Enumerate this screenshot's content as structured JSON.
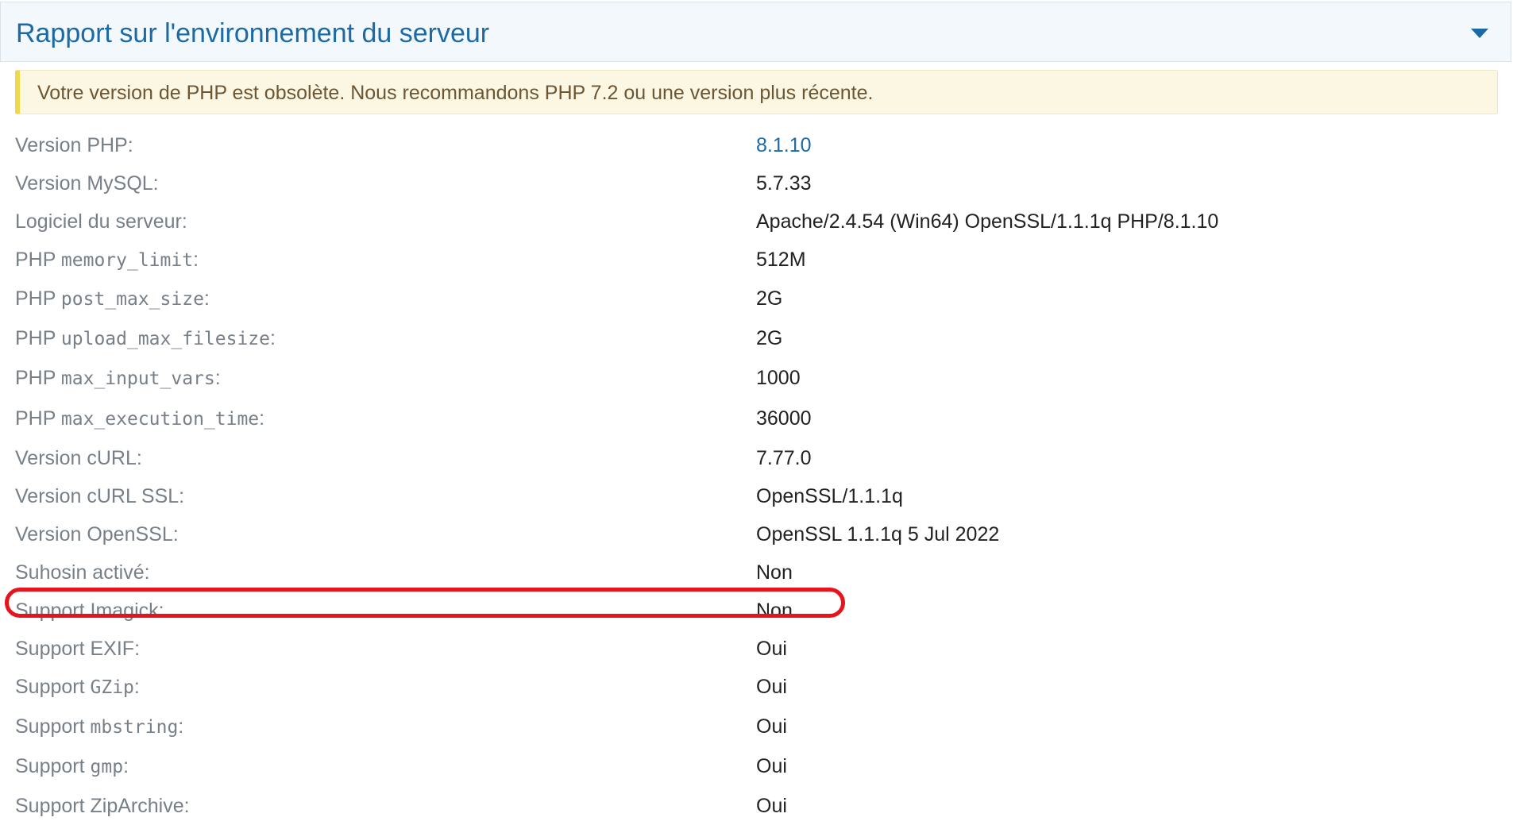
{
  "panel": {
    "title": "Rapport sur l'environnement du serveur",
    "toggle_icon": "caret-down-icon",
    "accent_color": "#1c6aa5"
  },
  "notice": {
    "text": "Votre version de PHP est obsolète. Nous recommandons PHP 7.2 ou une version plus récente.",
    "background_color": "#fcf7e3",
    "border_color": "#efd849"
  },
  "rows": [
    {
      "prefix": "Version PHP:",
      "code": "",
      "suffix": "",
      "value": "8.1.10"
    },
    {
      "prefix": "Version MySQL:",
      "code": "",
      "suffix": "",
      "value": "5.7.33"
    },
    {
      "prefix": "Logiciel du serveur:",
      "code": "",
      "suffix": "",
      "value": "Apache/2.4.54 (Win64) OpenSSL/1.1.1q PHP/8.1.10"
    },
    {
      "prefix": "PHP ",
      "code": "memory_limit",
      "suffix": ":",
      "value": "512M"
    },
    {
      "prefix": "PHP ",
      "code": "post_max_size",
      "suffix": ":",
      "value": "2G"
    },
    {
      "prefix": "PHP ",
      "code": "upload_max_filesize",
      "suffix": ":",
      "value": "2G"
    },
    {
      "prefix": "PHP ",
      "code": "max_input_vars",
      "suffix": ":",
      "value": "1000"
    },
    {
      "prefix": "PHP ",
      "code": "max_execution_time",
      "suffix": ":",
      "value": "36000"
    },
    {
      "prefix": "Version cURL:",
      "code": "",
      "suffix": "",
      "value": "7.77.0"
    },
    {
      "prefix": "Version cURL SSL:",
      "code": "",
      "suffix": "",
      "value": "OpenSSL/1.1.1q"
    },
    {
      "prefix": "Version OpenSSL:",
      "code": "",
      "suffix": "",
      "value": "OpenSSL 1.1.1q 5 Jul 2022"
    },
    {
      "prefix": "Suhosin activé:",
      "code": "",
      "suffix": "",
      "value": "Non"
    },
    {
      "prefix": "Support Imagick:",
      "code": "",
      "suffix": "",
      "value": "Non"
    },
    {
      "prefix": "Support EXIF:",
      "code": "",
      "suffix": "",
      "value": "Oui"
    },
    {
      "prefix": "Support ",
      "code": "GZip",
      "suffix": ":",
      "value": "Oui"
    },
    {
      "prefix": "Support ",
      "code": "mbstring",
      "suffix": ":",
      "value": "Oui"
    },
    {
      "prefix": "Support ",
      "code": "gmp",
      "suffix": ":",
      "value": "Oui"
    },
    {
      "prefix": "Support ZipArchive:",
      "code": "",
      "suffix": "",
      "value": "Oui"
    }
  ],
  "highlight": {
    "row_label": "Support Imagick:",
    "color": "#e8141c"
  }
}
